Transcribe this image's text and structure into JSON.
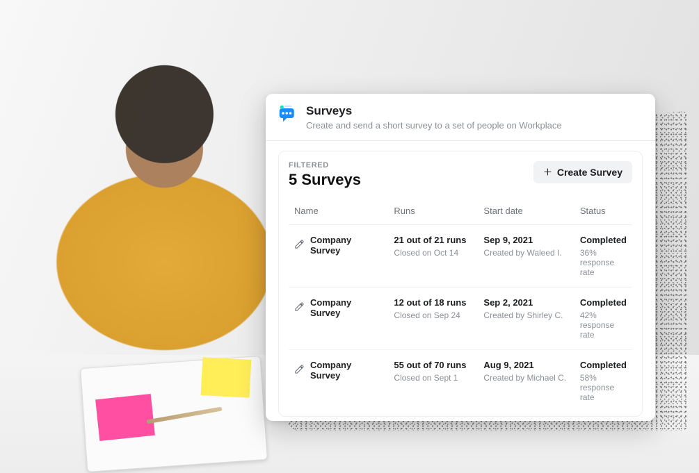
{
  "header": {
    "title": "Surveys",
    "subtitle": "Create and send a short survey to a set of people on Workplace",
    "icon_name": "survey-chat-icon"
  },
  "panel": {
    "filtered_label": "FILTERED",
    "count_title": "5 Surveys",
    "create_button_label": "Create Survey"
  },
  "table": {
    "columns": {
      "name": "Name",
      "runs": "Runs",
      "start_date": "Start date",
      "status": "Status"
    },
    "rows": [
      {
        "name": "Company Survey",
        "runs_primary": "21 out of 21 runs",
        "runs_secondary": "Closed on Oct 14",
        "start_primary": "Sep 9, 2021",
        "start_secondary": "Created by Waleed I.",
        "status_primary": "Completed",
        "status_secondary": "36% response rate"
      },
      {
        "name": "Company Survey",
        "runs_primary": "12 out of 18 runs",
        "runs_secondary": "Closed on Sep 24",
        "start_primary": "Sep 2, 2021",
        "start_secondary": "Created by Shirley C.",
        "status_primary": "Completed",
        "status_secondary": "42% response rate"
      },
      {
        "name": "Company Survey",
        "runs_primary": "55 out of 70 runs",
        "runs_secondary": "Closed on Sept 1",
        "start_primary": "Aug 9, 2021",
        "start_secondary": "Created by Michael C.",
        "status_primary": "Completed",
        "status_secondary": "58% response rate"
      }
    ]
  }
}
